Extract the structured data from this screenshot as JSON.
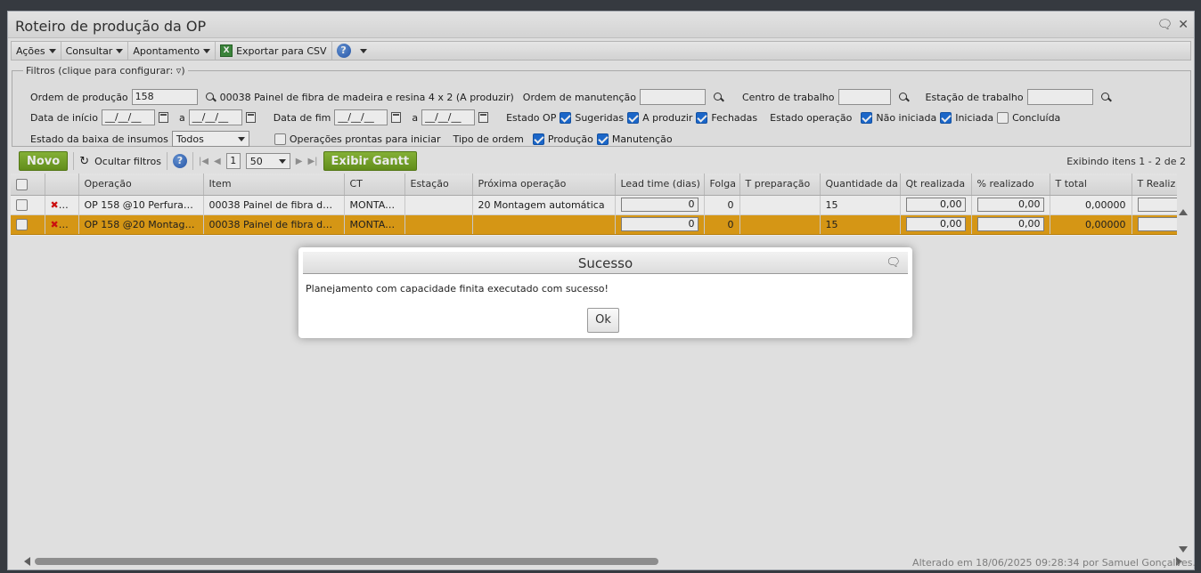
{
  "window": {
    "title": "Roteiro de produção da OP"
  },
  "menubar": {
    "acoes": "Ações",
    "consultar": "Consultar",
    "apontamento": "Apontamento",
    "exportar": "Exportar para CSV",
    "help": "?"
  },
  "filters": {
    "legend": "Filtros (clique para configurar:",
    "ordem_producao_label": "Ordem de produção",
    "ordem_producao_value": "158",
    "ordem_producao_desc": "00038 Painel de fibra de madeira e resina 4 x 2 (A produzir)",
    "ordem_manutencao_label": "Ordem de manutenção",
    "centro_trabalho_label": "Centro de trabalho",
    "estacao_trabalho_label": "Estação de trabalho",
    "data_inicio_label": "Data de início",
    "date_placeholder": "__/__/__",
    "a_label": "a",
    "data_fim_label": "Data de fim",
    "estado_op_label": "Estado OP",
    "sugeridas": "Sugeridas",
    "a_produzir": "A produzir",
    "fechadas": "Fechadas",
    "estado_operacao_label": "Estado operação",
    "nao_iniciada": "Não iniciada",
    "iniciada": "Iniciada",
    "concluida": "Concluída",
    "estado_baixa_label": "Estado da baixa de insumos",
    "estado_baixa_value": "Todos",
    "operacoes_prontas": "Operações prontas para iniciar",
    "tipo_ordem_label": "Tipo de ordem",
    "producao": "Produção",
    "manutencao": "Manutenção"
  },
  "toolbar": {
    "novo": "Novo",
    "ocultar_filtros": "Ocultar filtros",
    "help": "?",
    "page": "1",
    "page_size": "50",
    "exibir_gantt": "Exibir Gantt",
    "records": "Exibindo itens 1 - 2 de 2"
  },
  "grid": {
    "columns": [
      "Operação",
      "Item",
      "CT",
      "Estação",
      "Próxima operação",
      "Lead time (dias)",
      "Folga",
      "T preparação",
      "Quantidade da",
      "Qt realizada",
      "% realizado",
      "T total",
      "T Realiz"
    ],
    "rows": [
      {
        "operacao": "OP 158 @10 Perfuraç...",
        "item": "00038 Painel de fibra de ...",
        "ct": "MONTAG...",
        "estacao": "",
        "proxima": "20 Montagem automática",
        "lead": "0",
        "folga": "0",
        "prep": "",
        "qtd": "15",
        "qt_real": "0,00",
        "pct_real": "0,00",
        "t_total": "0,00000"
      },
      {
        "operacao": "OP 158 @20 Montage...",
        "item": "00038 Painel de fibra de ...",
        "ct": "MONTAG...",
        "estacao": "",
        "proxima": "",
        "lead": "0",
        "folga": "0",
        "prep": "",
        "qtd": "15",
        "qt_real": "0,00",
        "pct_real": "0,00",
        "t_total": "0,00000"
      }
    ]
  },
  "footer": {
    "text": "Alterado em 18/06/2025 09:28:34 por Samuel Gonçalves."
  },
  "dialog": {
    "title": "Sucesso",
    "message": "Planejamento com capacidade finita executado com sucesso!",
    "ok": "Ok"
  }
}
